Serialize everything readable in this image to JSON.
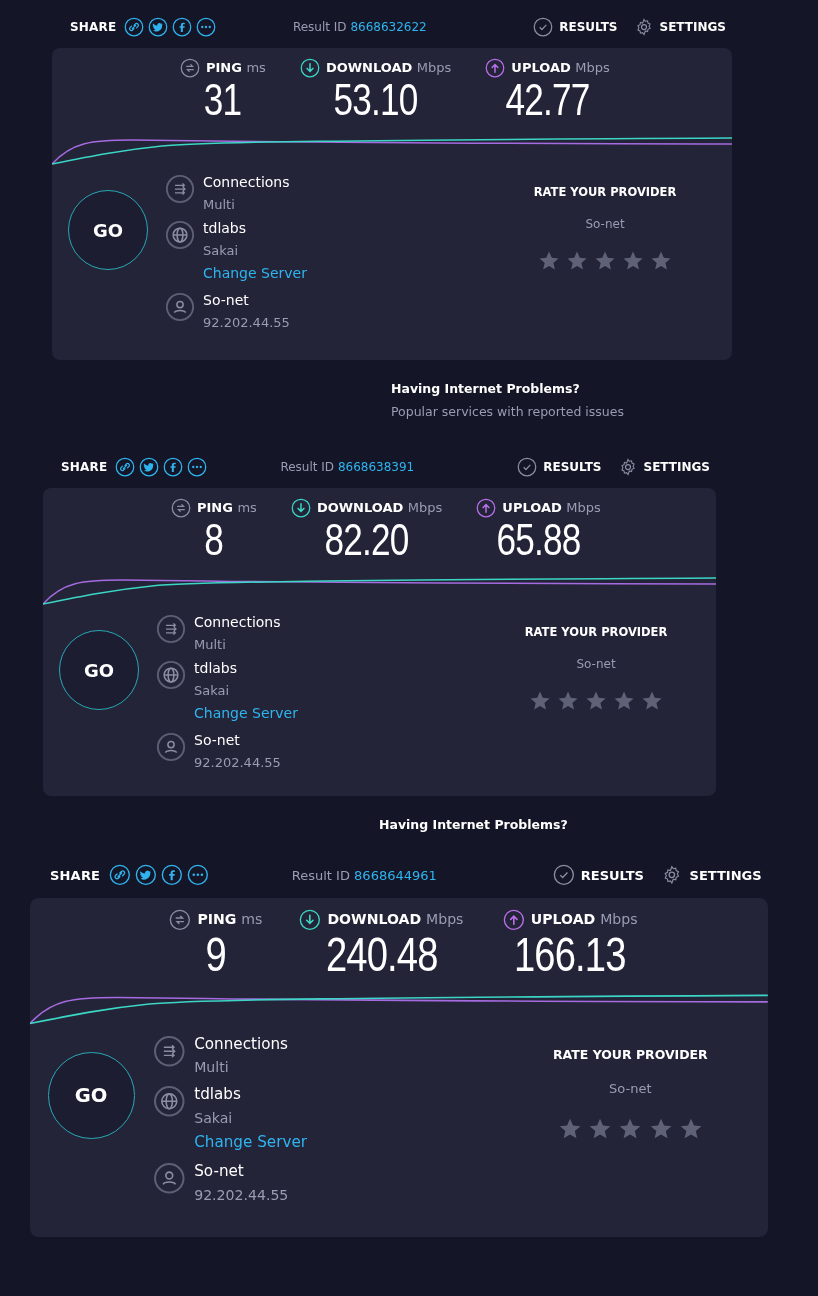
{
  "screens": [
    {
      "share_label": "SHARE",
      "result_id_label": "Result ID",
      "result_id": "8668632622",
      "results": "RESULTS",
      "settings": "SETTINGS",
      "metrics": [
        {
          "kind": "ping",
          "label": "PING",
          "unit": "ms",
          "value": "31"
        },
        {
          "kind": "download",
          "label": "DOWNLOAD",
          "unit": "Mbps",
          "value": "53.10"
        },
        {
          "kind": "upload",
          "label": "UPLOAD",
          "unit": "Mbps",
          "value": "42.77"
        }
      ],
      "go": "GO",
      "info": [
        {
          "kind": "connections",
          "title": "Connections",
          "detail": "Multi"
        },
        {
          "kind": "server",
          "title": "tdlabs",
          "detail": "Sakai",
          "link": "Change Server"
        },
        {
          "kind": "isp",
          "title": "So-net",
          "detail": "92.202.44.55"
        }
      ],
      "rating": {
        "title": "RATE YOUR PROVIDER",
        "provider": "So-net",
        "stars": 0
      },
      "problems": {
        "title": "Having Internet Problems?",
        "subtitle": "Popular services with reported issues"
      }
    },
    {
      "share_label": "SHARE",
      "result_id_label": "Result ID",
      "result_id": "8668638391",
      "results": "RESULTS",
      "settings": "SETTINGS",
      "metrics": [
        {
          "kind": "ping",
          "label": "PING",
          "unit": "ms",
          "value": "8"
        },
        {
          "kind": "download",
          "label": "DOWNLOAD",
          "unit": "Mbps",
          "value": "82.20"
        },
        {
          "kind": "upload",
          "label": "UPLOAD",
          "unit": "Mbps",
          "value": "65.88"
        }
      ],
      "go": "GO",
      "info": [
        {
          "kind": "connections",
          "title": "Connections",
          "detail": "Multi"
        },
        {
          "kind": "server",
          "title": "tdlabs",
          "detail": "Sakai",
          "link": "Change Server"
        },
        {
          "kind": "isp",
          "title": "So-net",
          "detail": "92.202.44.55"
        }
      ],
      "rating": {
        "title": "RATE YOUR PROVIDER",
        "provider": "So-net",
        "stars": 0
      },
      "problems": {
        "title": "Having Internet Problems?"
      }
    },
    {
      "share_label": "SHARE",
      "result_id_label": "Result ID",
      "result_id": "8668644961",
      "results": "RESULTS",
      "settings": "SETTINGS",
      "metrics": [
        {
          "kind": "ping",
          "label": "PING",
          "unit": "ms",
          "value": "9"
        },
        {
          "kind": "download",
          "label": "DOWNLOAD",
          "unit": "Mbps",
          "value": "240.48"
        },
        {
          "kind": "upload",
          "label": "UPLOAD",
          "unit": "Mbps",
          "value": "166.13"
        }
      ],
      "go": "GO",
      "info": [
        {
          "kind": "connections",
          "title": "Connections",
          "detail": "Multi"
        },
        {
          "kind": "server",
          "title": "tdlabs",
          "detail": "Sakai",
          "link": "Change Server"
        },
        {
          "kind": "isp",
          "title": "So-net",
          "detail": "92.202.44.55"
        }
      ],
      "rating": {
        "title": "RATE YOUR PROVIDER",
        "provider": "So-net",
        "stars": 0
      }
    }
  ]
}
